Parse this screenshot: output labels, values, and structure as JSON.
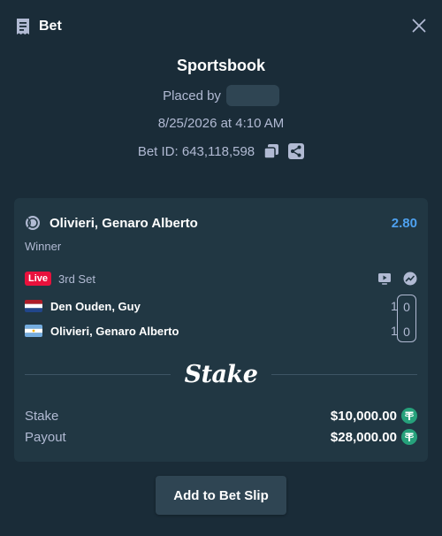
{
  "header": {
    "title": "Bet",
    "icon": "receipt-icon",
    "close_icon": "close-icon"
  },
  "meta": {
    "title": "Sportsbook",
    "placed_by_label": "Placed by",
    "date": "8/25/2026 at 4:10 AM",
    "bet_id": "Bet ID: 643,118,598"
  },
  "selection": {
    "icon": "tennis-ball-icon",
    "name": "Olivieri, Genaro Alberto",
    "odds": "2.80",
    "market": "Winner"
  },
  "live": {
    "badge": "Live",
    "set": "3rd Set",
    "icons": [
      "live-stream-icon",
      "stats-icon"
    ]
  },
  "teams": [
    {
      "name": "Den Ouden, Guy",
      "sets": "1",
      "score": "0",
      "flag": "netherlands-flag-icon"
    },
    {
      "name": "Olivieri, Genaro Alberto",
      "sets": "1",
      "score": "0",
      "flag": "argentina-flag-icon"
    }
  ],
  "logo_text": "Stake",
  "summary": {
    "stake_label": "Stake",
    "stake_value": "$10,000.00",
    "payout_label": "Payout",
    "payout_value": "$28,000.00",
    "currency_icon": "usdt-coin-icon"
  },
  "button_label": "Add to Bet Slip",
  "colors": {
    "background": "#1a2c38",
    "card": "#213743",
    "odds": "#4ea1f0",
    "live_badge": "#e9113c",
    "coin": "#26a17b",
    "muted_text": "#b1bad3"
  }
}
